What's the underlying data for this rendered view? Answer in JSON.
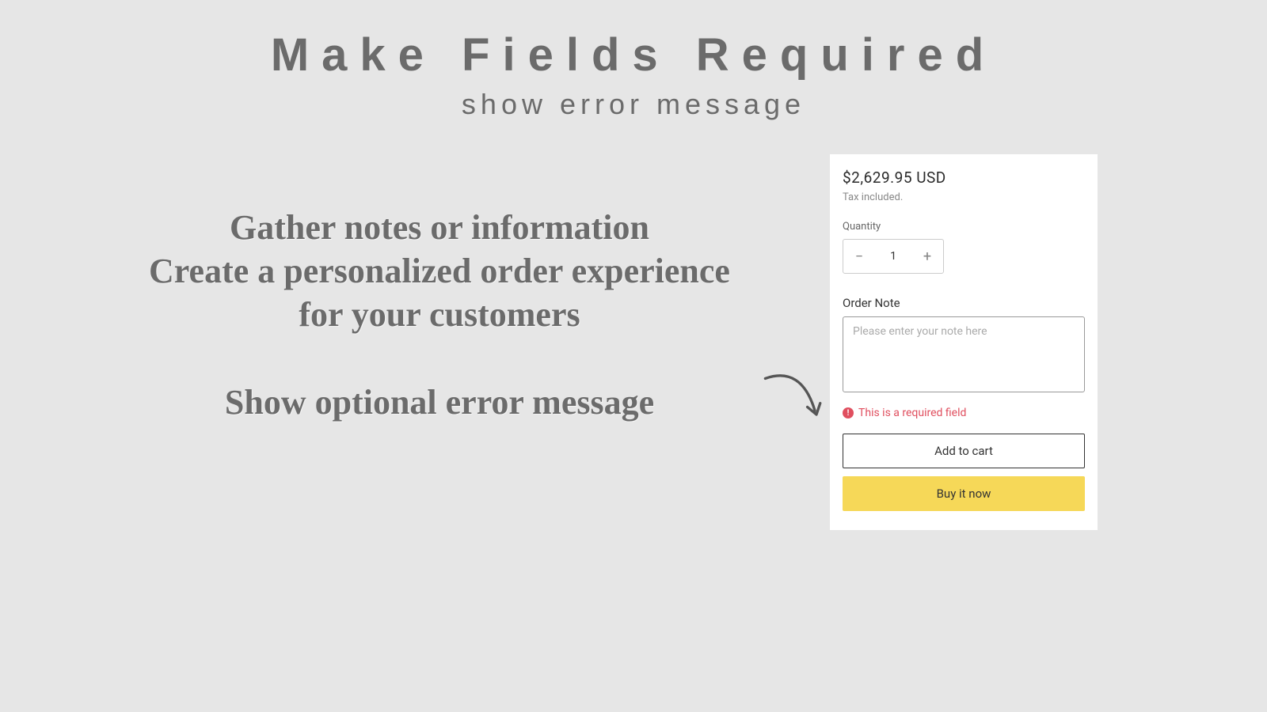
{
  "header": {
    "title": "Make Fields Required",
    "subtitle": "show error message"
  },
  "body": {
    "line1": "Gather notes or information",
    "line2": "Create a personalized order experience",
    "line3": "for your customers",
    "line4": "Show optional error message"
  },
  "product": {
    "price": "$2,629.95 USD",
    "tax_note": "Tax included.",
    "quantity_label": "Quantity",
    "quantity_value": "1",
    "note_label": "Order Note",
    "note_placeholder": "Please enter your note here",
    "error_message": "This is a required field",
    "add_to_cart": "Add to cart",
    "buy_now": "Buy it now"
  },
  "colors": {
    "bg": "#e6e6e6",
    "text_main": "#6b6b6b",
    "error": "#e04f5f",
    "buy_now_bg": "#f6d858"
  }
}
